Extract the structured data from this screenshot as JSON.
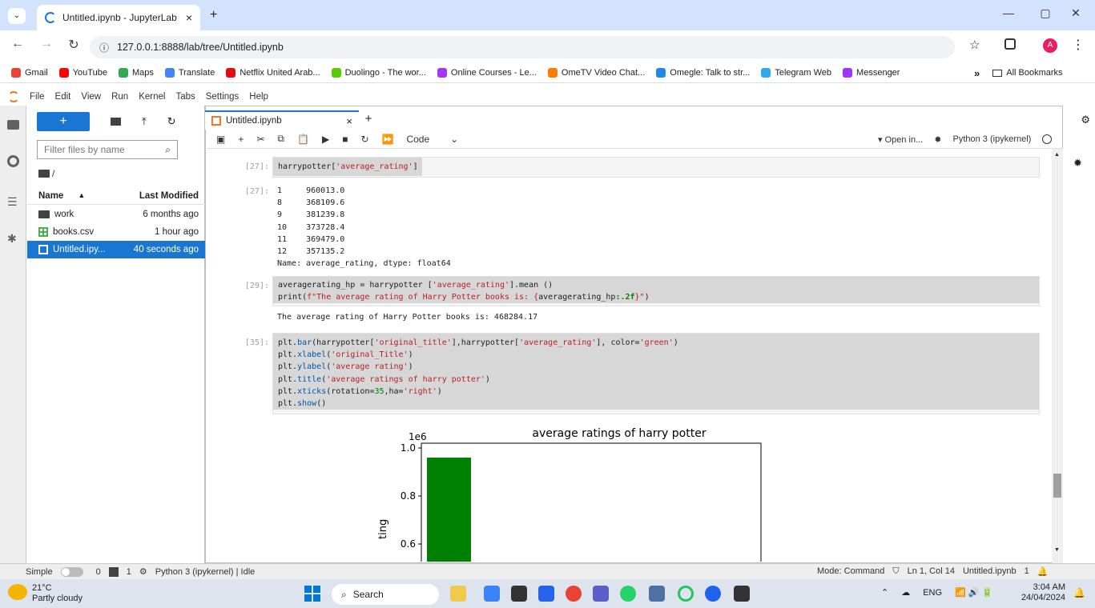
{
  "browser": {
    "tab_title": "Untitled.ipynb - JupyterLab",
    "tab_close": "×",
    "new_tab": "+",
    "url": "127.0.0.1:8888/lab/tree/Untitled.ipynb",
    "profile_initial": "A",
    "bookmarks": [
      {
        "label": "Gmail",
        "color": "#ea4335"
      },
      {
        "label": "YouTube",
        "color": "#ff0000"
      },
      {
        "label": "Maps",
        "color": "#34a853"
      },
      {
        "label": "Translate",
        "color": "#4285f4"
      },
      {
        "label": "Netflix United Arab...",
        "color": "#e50914"
      },
      {
        "label": "Duolingo - The wor...",
        "color": "#58cc02"
      },
      {
        "label": "Online Courses - Le...",
        "color": "#a435f0"
      },
      {
        "label": "OmeTV Video Chat...",
        "color": "#ff7a00"
      },
      {
        "label": "Omegle: Talk to str...",
        "color": "#1e88e5"
      },
      {
        "label": "Telegram Web",
        "color": "#2aabee"
      },
      {
        "label": "Messenger",
        "color": "#a033ff"
      }
    ],
    "more_bookmarks": "»",
    "all_bookmarks": "All Bookmarks"
  },
  "jupyter": {
    "menu": [
      "File",
      "Edit",
      "View",
      "Run",
      "Kernel",
      "Tabs",
      "Settings",
      "Help"
    ],
    "filebrowser": {
      "new_label": "+",
      "filter_placeholder": "Filter files by name",
      "breadcrumb": "/",
      "col_name": "Name",
      "col_modified": "Last Modified",
      "files": [
        {
          "name": "work",
          "modified": "6 months ago",
          "type": "folder"
        },
        {
          "name": "books.csv",
          "modified": "1 hour ago",
          "type": "csv"
        },
        {
          "name": "Untitled.ipy...",
          "modified": "40 seconds ago",
          "type": "notebook"
        }
      ]
    },
    "doc_tab": "Untitled.ipynb",
    "cell_type": "Code",
    "open_in": "Open in...",
    "kernel_name": "Python 3 (ipykernel)",
    "cells": {
      "c1_prompt": "[27]:",
      "c1_out_prompt": "[27]:",
      "c1_output": "1     960013.0\n8     368109.6\n9     381239.8\n10    373728.4\n11    369479.0\n12    357135.2\nName: average_rating, dtype: float64",
      "c2_prompt": "[29]:",
      "c2_output": "The average rating of Harry Potter books is: 468284.17",
      "c3_prompt": "[35]:"
    },
    "plot": {
      "title": "average ratings of harry potter",
      "exponent": "1e6",
      "ylabel_partial": "ting",
      "yticks": [
        "1.0",
        "0.8",
        "0.6"
      ],
      "bar_color": "#008000"
    },
    "chart_data": {
      "type": "bar",
      "title": "average ratings of harry potter",
      "ylabel": "average rating",
      "xlabel": "original_Title",
      "values": [
        960013.0,
        368109.6,
        381239.8,
        373728.4,
        369479.0,
        357135.2
      ],
      "y_visible_range": [
        550000,
        1030000
      ],
      "yticks_labels": [
        "1.0",
        "0.8",
        "0.6"
      ],
      "y_exponent": "1e6"
    },
    "status": {
      "mode_simple": "Simple",
      "terminals": "0",
      "kernels": "1",
      "kernel_status": "Python 3 (ipykernel) | Idle",
      "mode": "Mode: Command",
      "cursor": "Ln 1, Col 14",
      "file": "Untitled.ipynb",
      "notif_count": "1"
    }
  },
  "taskbar": {
    "weather_temp": "21°C",
    "weather_desc": "Partly cloudy",
    "search": "Search",
    "lang": "ENG",
    "time": "3:04 AM",
    "date": "24/04/2024"
  }
}
